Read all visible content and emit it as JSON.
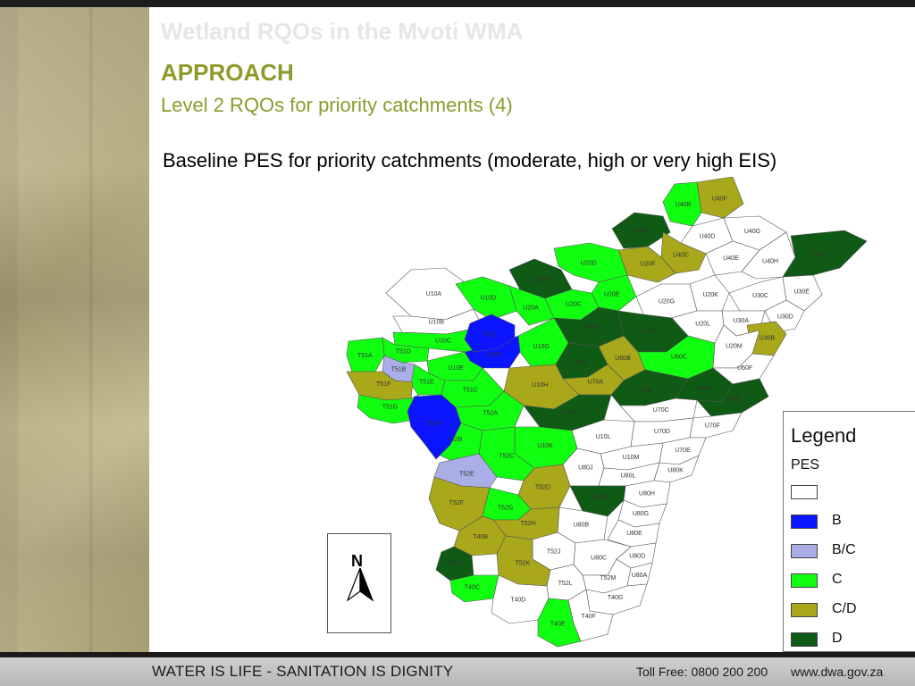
{
  "header": {
    "ghost_title": "Wetland RQOs in the Mvoti WMA",
    "section": "APPROACH",
    "subtitle": "Level 2 RQOs for priority catchments (4)",
    "caption": "Baseline PES for priority catchments (moderate, high or very high EIS)"
  },
  "colors": {
    "none": "#ffffff",
    "B": "#0a14ff",
    "B/C": "#a9afe6",
    "C": "#10ff10",
    "C/D": "#a8a81a",
    "D": "#0f5a14",
    "heading": "#8e9a2b"
  },
  "map": {
    "north_label": "N",
    "catchments": [
      {
        "code": "U40B",
        "cls": "C"
      },
      {
        "code": "U40F",
        "cls": "C/D"
      },
      {
        "code": "U40A",
        "cls": "D"
      },
      {
        "code": "U40D",
        "cls": "none"
      },
      {
        "code": "U40G",
        "cls": "none"
      },
      {
        "code": "U40C",
        "cls": "C/D"
      },
      {
        "code": "U20F",
        "cls": "C/D"
      },
      {
        "code": "U40E",
        "cls": "none"
      },
      {
        "code": "U40H",
        "cls": "none"
      },
      {
        "code": "U30B",
        "cls": "D"
      },
      {
        "code": "U20D",
        "cls": "C"
      },
      {
        "code": "U20B",
        "cls": "D"
      },
      {
        "code": "U20E",
        "cls": "C"
      },
      {
        "code": "U10A",
        "cls": "none"
      },
      {
        "code": "U10D",
        "cls": "C"
      },
      {
        "code": "U20A",
        "cls": "C"
      },
      {
        "code": "U20C",
        "cls": "C"
      },
      {
        "code": "U20G",
        "cls": "none"
      },
      {
        "code": "U20K",
        "cls": "none"
      },
      {
        "code": "U30C",
        "cls": "none"
      },
      {
        "code": "U30E",
        "cls": "none"
      },
      {
        "code": "U10B",
        "cls": "none"
      },
      {
        "code": "U30A",
        "cls": "none"
      },
      {
        "code": "U30D",
        "cls": "none"
      },
      {
        "code": "U10C",
        "cls": "C"
      },
      {
        "code": "T51D",
        "cls": "C"
      },
      {
        "code": "U20H",
        "cls": "D"
      },
      {
        "code": "U20J",
        "cls": "D"
      },
      {
        "code": "U20L",
        "cls": "none"
      },
      {
        "code": "U30B2",
        "label": "U30B",
        "cls": "C/D"
      },
      {
        "code": "T51A",
        "cls": "C"
      },
      {
        "code": "T51B",
        "cls": "B/C"
      },
      {
        "code": "U10G",
        "cls": "C"
      },
      {
        "code": "U10F",
        "cls": "B"
      },
      {
        "code": "U10E",
        "cls": "C"
      },
      {
        "code": "T51E",
        "cls": "C"
      },
      {
        "code": "U60A",
        "cls": "D"
      },
      {
        "code": "U60B",
        "cls": "C/D"
      },
      {
        "code": "U60C",
        "cls": "C"
      },
      {
        "code": "U20M",
        "cls": "none"
      },
      {
        "code": "U70A",
        "cls": "C/D"
      },
      {
        "code": "T51F",
        "cls": "C/D"
      },
      {
        "code": "U60F",
        "cls": "none"
      },
      {
        "code": "U10H",
        "cls": "C/D"
      },
      {
        "code": "T51C",
        "cls": "C"
      },
      {
        "code": "U70B",
        "cls": "D"
      },
      {
        "code": "U60D",
        "cls": "D"
      },
      {
        "code": "T51G",
        "cls": "C"
      },
      {
        "code": "T52A",
        "cls": "C"
      },
      {
        "code": "U10J",
        "cls": "D"
      },
      {
        "code": "U70C",
        "cls": "none"
      },
      {
        "code": "U60E",
        "cls": "D"
      },
      {
        "code": "U10L",
        "cls": "none"
      },
      {
        "code": "U70D",
        "cls": "none"
      },
      {
        "code": "U70F",
        "cls": "none"
      },
      {
        "code": "T52B",
        "cls": "C"
      },
      {
        "code": "U10K",
        "cls": "C"
      },
      {
        "code": "U10M",
        "cls": "none"
      },
      {
        "code": "U70E",
        "cls": "none"
      },
      {
        "code": "U80J",
        "cls": "none"
      },
      {
        "code": "U80L",
        "cls": "none"
      },
      {
        "code": "T52C",
        "cls": "C"
      },
      {
        "code": "U80K",
        "cls": "none"
      },
      {
        "code": "T52E",
        "cls": "B/C"
      },
      {
        "code": "T52D",
        "cls": "C/D"
      },
      {
        "code": "U80H",
        "cls": "none"
      },
      {
        "code": "U80F",
        "cls": "D"
      },
      {
        "code": "U80G",
        "cls": "none"
      },
      {
        "code": "T52F",
        "cls": "C/D"
      },
      {
        "code": "T52G",
        "cls": "C"
      },
      {
        "code": "U80B",
        "cls": "none"
      },
      {
        "code": "U80E",
        "cls": "none"
      },
      {
        "code": "T52H",
        "cls": "C/D"
      },
      {
        "code": "U80D",
        "cls": "none"
      },
      {
        "code": "T40B",
        "cls": "C/D"
      },
      {
        "code": "T52J",
        "cls": "none"
      },
      {
        "code": "U80C",
        "cls": "none"
      },
      {
        "code": "T52K",
        "cls": "C/D"
      },
      {
        "code": "T52M",
        "cls": "none"
      },
      {
        "code": "U80A",
        "cls": "none"
      },
      {
        "code": "T40A",
        "cls": "D"
      },
      {
        "code": "T52L",
        "cls": "none"
      },
      {
        "code": "T40C",
        "cls": "C"
      },
      {
        "code": "T40G",
        "cls": "none"
      },
      {
        "code": "T40D",
        "cls": "none"
      },
      {
        "code": "T40E",
        "cls": "C"
      },
      {
        "code": "T40F",
        "cls": "none"
      },
      {
        "code": "T51H",
        "cls": "B"
      },
      {
        "code": "T51J",
        "cls": "B"
      }
    ]
  },
  "legend": {
    "title": "Legend",
    "subtitle": "PES",
    "items": [
      {
        "label": "",
        "color": "#ffffff"
      },
      {
        "label": "B",
        "color": "#0a14ff"
      },
      {
        "label": "B/C",
        "color": "#a9afe6"
      },
      {
        "label": "C",
        "color": "#10ff10"
      },
      {
        "label": "C/D",
        "color": "#a8a81a"
      },
      {
        "label": "D",
        "color": "#0f5a14"
      }
    ]
  },
  "footer": {
    "motto": "WATER IS LIFE - SANITATION IS DIGNITY",
    "toll_free": "Toll Free: 0800 200 200",
    "website": "www.dwa.gov.za"
  }
}
